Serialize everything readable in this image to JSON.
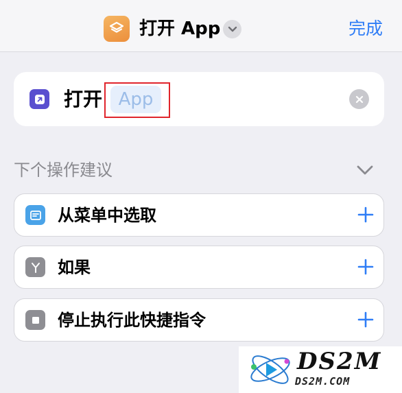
{
  "header": {
    "title": "打开 App",
    "done_label": "完成",
    "app_icon": "shortcuts-icon"
  },
  "action": {
    "verb": "打开",
    "parameter_placeholder": "App",
    "icon": "open-app-icon"
  },
  "suggestions": {
    "title": "下个操作建议",
    "items": [
      {
        "label": "从菜单中选取",
        "icon": "menu-list-icon",
        "color": "#4aa3e8"
      },
      {
        "label": "如果",
        "icon": "branch-icon",
        "color": "#8e8e93"
      },
      {
        "label": "停止执行此快捷指令",
        "icon": "stop-icon",
        "color": "#8e8e93"
      }
    ]
  },
  "watermark": {
    "text": "DS2M",
    "sub": "DS2M.COM"
  },
  "colors": {
    "accent": "#2f7df6",
    "highlight": "#e0242b",
    "action_icon": "#5a4fcf",
    "app_icon": "#f0a24b"
  }
}
